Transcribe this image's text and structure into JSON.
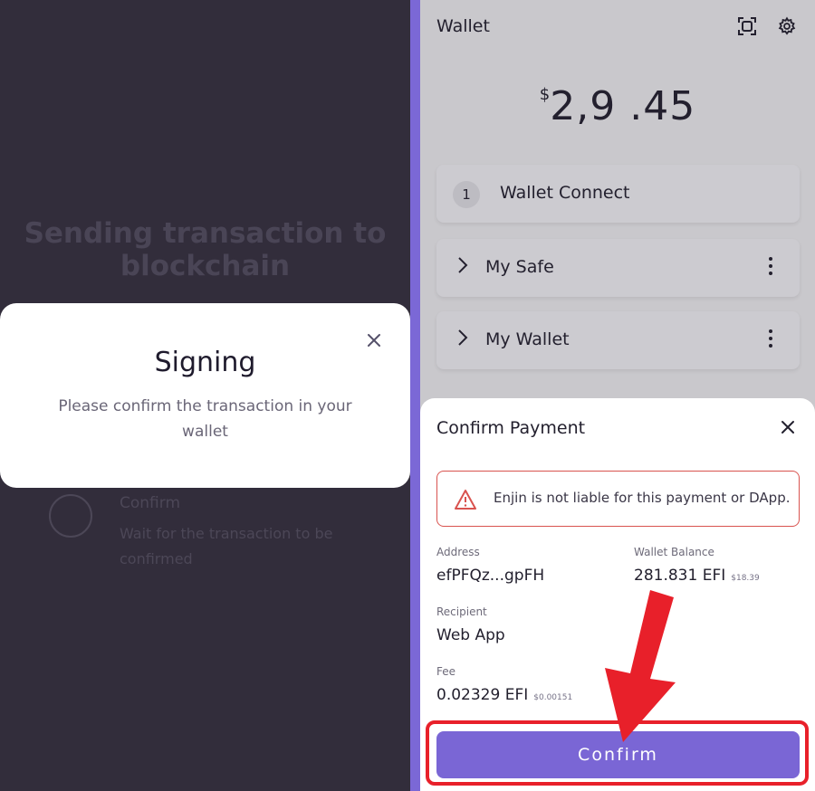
{
  "left": {
    "heading_line1": "Sending transaction to",
    "heading_line2": "blockchain",
    "step_title": "Confirm",
    "step_desc": "Wait for the transaction to be confirmed",
    "modal_title": "Signing",
    "modal_text": "Please confirm the transaction in your wallet"
  },
  "wallet": {
    "title": "Wallet",
    "balance_symbol": "$",
    "balance_value": "2,9  .45",
    "cards": {
      "connect_badge": "1",
      "connect_label": "Wallet Connect",
      "safe_label": "My Safe",
      "wallet_label": "My Wallet"
    }
  },
  "sheet": {
    "title": "Confirm Payment",
    "warning": "Enjin is not liable for this payment or DApp.",
    "address_label": "Address",
    "address_value": "efPFQz...gpFH",
    "balance_label": "Wallet Balance",
    "balance_value": "281.831 EFI",
    "balance_fiat": "$18.39",
    "recipient_label": "Recipient",
    "recipient_value": "Web App",
    "fee_label": "Fee",
    "fee_value": "0.02329 EFI",
    "fee_fiat": "$0.00151",
    "confirm_label": "Confirm"
  },
  "colors": {
    "accent": "#7a66d5",
    "annotation_red": "#e8202a",
    "dark_bg": "#322d3b"
  }
}
